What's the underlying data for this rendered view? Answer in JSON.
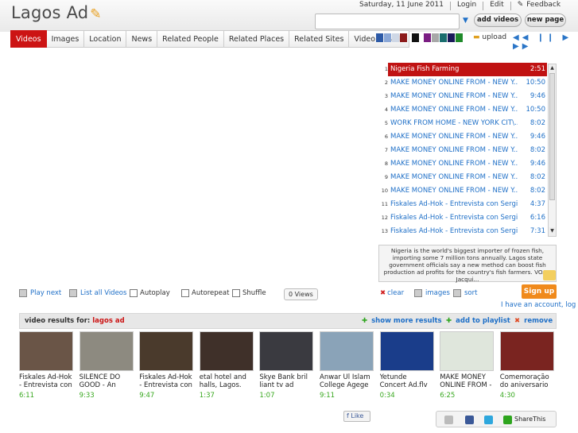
{
  "app": {
    "title": "Lagos Ad"
  },
  "toplinks": {
    "date": "Saturday, 11 June 2011",
    "login": "Login",
    "edit": "Edit",
    "feedback": "Feedback"
  },
  "header": {
    "add_videos": "add videos",
    "new_page": "new page",
    "search_placeholder": ""
  },
  "tabs": [
    "Videos",
    "Images",
    "Location",
    "News",
    "Related People",
    "Related Places",
    "Related Sites",
    "Video Details"
  ],
  "toolbar": {
    "upload": "upload",
    "swatches": [
      "#2d5aa7",
      "#8aa7d7",
      "#cfd8e6",
      "#8c1a1a",
      "#111111",
      "#7a1d82",
      "#a8a8a8",
      "#1a6e6e",
      "#1a1a5a",
      "#1f8a2a"
    ]
  },
  "playlist": [
    {
      "n": "1",
      "title": "Nigeria Fish Farming",
      "dur": "2:51"
    },
    {
      "n": "2",
      "title": "MAKE MONEY ONLINE FROM - NEW Y...",
      "dur": "10:50"
    },
    {
      "n": "3",
      "title": "MAKE MONEY ONLINE FROM - NEW Y...",
      "dur": "9:46"
    },
    {
      "n": "4",
      "title": "MAKE MONEY ONLINE FROM - NEW Y...",
      "dur": "10:50"
    },
    {
      "n": "5",
      "title": "WORK FROM HOME - NEW YORK CIT\\...",
      "dur": "8:02"
    },
    {
      "n": "6",
      "title": "MAKE MONEY ONLINE FROM - NEW Y...",
      "dur": "9:46"
    },
    {
      "n": "7",
      "title": "MAKE MONEY ONLINE FROM - NEW Y...",
      "dur": "8:02"
    },
    {
      "n": "8",
      "title": "MAKE MONEY ONLINE FROM - NEW Y...",
      "dur": "9:46"
    },
    {
      "n": "9",
      "title": "MAKE MONEY ONLINE FROM - NEW Y...",
      "dur": "8:02"
    },
    {
      "n": "10",
      "title": "MAKE MONEY ONLINE FROM - NEW Y...",
      "dur": "8:02"
    },
    {
      "n": "11",
      "title": "Fiskales Ad-Hok - Entrevista con Sergio...",
      "dur": "4:37"
    },
    {
      "n": "12",
      "title": "Fiskales Ad-Hok - Entrevista con Sergio...",
      "dur": "6:16"
    },
    {
      "n": "13",
      "title": "Fiskales Ad-Hok - Entrevista con Sergio...",
      "dur": "7:31"
    }
  ],
  "description": "Nigeria is the world's biggest importer of frozen fish, importing some 7 million tons annually. Lagos state government officials say a new method can boost fish production ad profits for the country's fish farmers. VOA's Jacqui...",
  "player_controls": {
    "play_next": "Play next",
    "list_all": "List all Videos",
    "autoplay": "Autoplay",
    "autorepeat": "Autorepeat",
    "shuffle": "Shuffle",
    "views": "0 Views",
    "clear": "clear",
    "images": "images",
    "sort": "sort"
  },
  "account": {
    "signup": "Sign up",
    "have_account": "I have an account, log"
  },
  "results": {
    "label": "video results for:",
    "query": "lagos ad",
    "show_more": "show more results",
    "add_playlist": "add to playlist",
    "remove": "remove"
  },
  "thumbs": [
    {
      "title": "Fiskales Ad-Hok - Entrevista con",
      "dur": "6:11",
      "bg": "#6a5547"
    },
    {
      "title": "SILENCE DO GOOD - An Instal",
      "dur": "9:33",
      "bg": "#8d8a80"
    },
    {
      "title": "Fiskales Ad-Hok - Entrevista con",
      "dur": "9:47",
      "bg": "#4a3a2c"
    },
    {
      "title": "etal hotel and halls, Lagos.",
      "dur": "1:37",
      "bg": "#3f3029"
    },
    {
      "title": "Skye Bank bril liant tv ad",
      "dur": "1:07",
      "bg": "#3a3a40"
    },
    {
      "title": "Anwar Ul Islam College Agege",
      "dur": "9:11",
      "bg": "#8aa3b8"
    },
    {
      "title": "Yetunde Concert Ad.flv",
      "dur": "0:34",
      "bg": "#1a3d8a"
    },
    {
      "title": "MAKE MONEY ONLINE FROM --",
      "dur": "6:25",
      "bg": "#dfe6dc"
    },
    {
      "title": "Comemoração do aniversario do",
      "dur": "4:30",
      "bg": "#7a2420"
    }
  ],
  "social": {
    "like": "Like",
    "sharethis": "ShareThis"
  },
  "colors": {
    "accent_red": "#cc1414",
    "link_blue": "#1e6fc7",
    "signup_orange": "#f08a1c",
    "duration_green": "#38a81f"
  }
}
